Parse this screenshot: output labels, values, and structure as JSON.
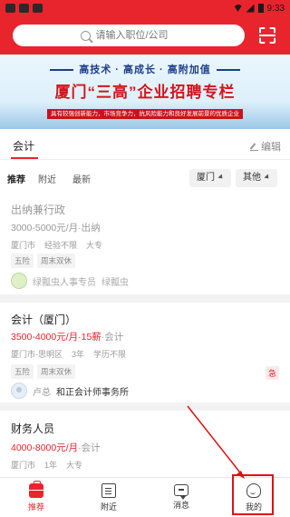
{
  "status_bar": {
    "time": "9:33"
  },
  "header": {
    "search_placeholder": "请输入职位/公司"
  },
  "banner": {
    "line1": "高技术 · 高成长 · 高附加值",
    "line2": "厦门“三高”企业招聘专栏",
    "line3": "具有较强创新能力，市场竞争力，抗风险能力和良好发展前景的优质企业"
  },
  "category_tabs": {
    "active": "会计",
    "edit_label": "编辑"
  },
  "filters": {
    "tabs": [
      "推荐",
      "附近",
      "最新"
    ],
    "city": "厦门",
    "other": "其他"
  },
  "jobs": [
    {
      "title": "出纳兼行政",
      "salary": "3000-5000元/月·出纳",
      "meta": [
        "厦门市",
        "经验不限",
        "大专"
      ],
      "tags": [
        "五险",
        "周末双休"
      ],
      "hr_name": "绿瓢虫人事专员",
      "company": "绿瓢虫"
    },
    {
      "title": "会计（厦门）",
      "salary_main": "3500-4000元/月·15薪",
      "salary_suffix": "·会计",
      "meta": [
        "厦门市-思明区",
        "3年",
        "学历不限"
      ],
      "tags": [
        "五险",
        "周末双休"
      ],
      "urgent": "急",
      "hr_name": "卢总",
      "company": "和正会计师事务所"
    },
    {
      "title": "财务人员",
      "salary_main": "4000-8000元/月",
      "salary_suffix": "·会计",
      "meta": [
        "厦门市",
        "1年",
        "大专"
      ],
      "tags": []
    }
  ],
  "bottom_nav": [
    {
      "label": "推荐",
      "icon": "briefcase-icon",
      "active": true
    },
    {
      "label": "附近",
      "icon": "document-icon",
      "active": false
    },
    {
      "label": "消息",
      "icon": "message-icon",
      "active": false
    },
    {
      "label": "我的",
      "icon": "user-icon",
      "active": false
    }
  ],
  "colors": {
    "brand": "#e8242d",
    "highlight_box": "#e01010"
  }
}
